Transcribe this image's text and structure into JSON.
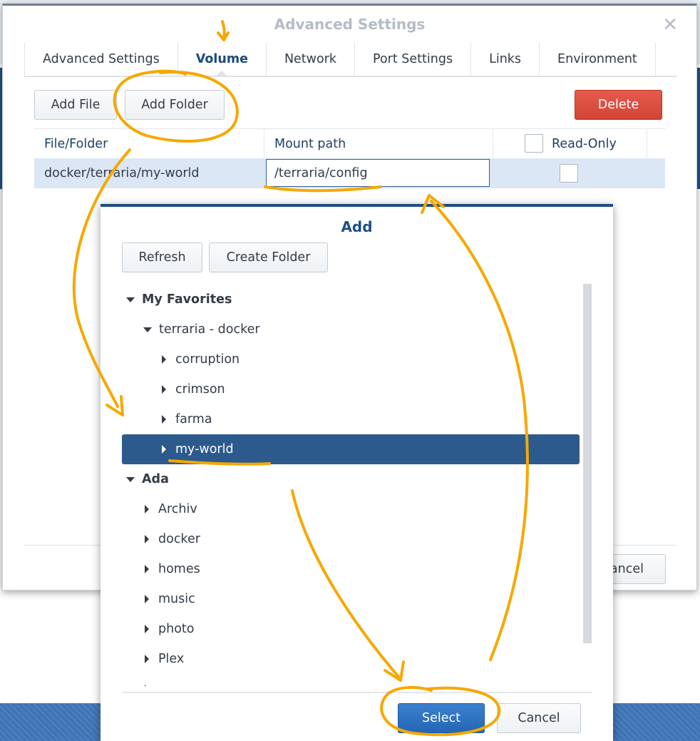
{
  "window": {
    "title": "Advanced Settings",
    "tabs": [
      {
        "label": "Advanced Settings",
        "active": false
      },
      {
        "label": "Volume",
        "active": true
      },
      {
        "label": "Network",
        "active": false
      },
      {
        "label": "Port Settings",
        "active": false
      },
      {
        "label": "Links",
        "active": false
      },
      {
        "label": "Environment",
        "active": false
      }
    ],
    "toolbar": {
      "add_file": "Add File",
      "add_folder": "Add Folder",
      "delete": "Delete"
    },
    "table": {
      "headers": {
        "file_folder": "File/Folder",
        "mount_path": "Mount path",
        "read_only": "Read-Only"
      },
      "row": {
        "file_folder": "docker/terraria/my-world",
        "mount_path": "/terraria/config",
        "read_only": false
      }
    },
    "footer": {
      "cancel_partial": "ancel"
    }
  },
  "dialog": {
    "title": "Add",
    "refresh": "Refresh",
    "create_folder": "Create Folder",
    "tree": {
      "favorites": "My Favorites",
      "terraria_docker": "terraria - docker",
      "fav_children": [
        "corruption",
        "crimson",
        "farma",
        "my-world"
      ],
      "ada": "Ada",
      "ada_children": [
        "Archiv",
        "docker",
        "homes",
        "music",
        "photo",
        "Plex"
      ]
    },
    "select": "Select",
    "cancel": "Cancel"
  },
  "colors": {
    "accent": "#2d5a8c",
    "delete": "#d9473a",
    "annotation": "#f5a800"
  }
}
